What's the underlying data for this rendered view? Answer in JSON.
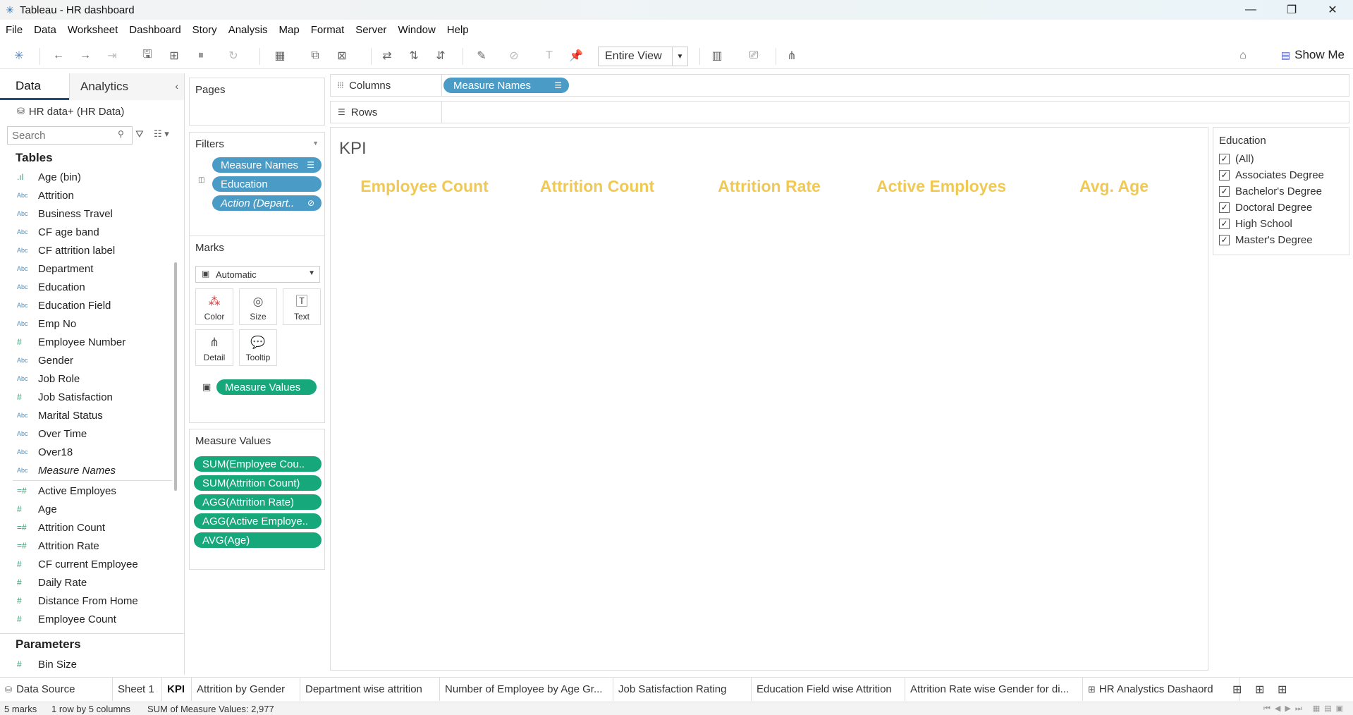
{
  "window": {
    "title": "Tableau - HR dashboard",
    "minimize": "—",
    "restore": "❐",
    "close": "✕"
  },
  "menu": [
    "File",
    "Data",
    "Worksheet",
    "Dashboard",
    "Story",
    "Analysis",
    "Map",
    "Format",
    "Server",
    "Window",
    "Help"
  ],
  "toolbar": {
    "view_mode": "Entire View",
    "show_me": "Show Me"
  },
  "left_panel": {
    "tabs": {
      "data": "Data",
      "analytics": "Analytics"
    },
    "datasource": "HR data+ (HR Data)",
    "search_placeholder": "Search",
    "tables_heading": "Tables",
    "dimensions": [
      {
        "type": "bin",
        "name": "Age (bin)"
      },
      {
        "type": "Abc",
        "name": "Attrition"
      },
      {
        "type": "Abc",
        "name": "Business Travel"
      },
      {
        "type": "Abc",
        "name": "CF age band"
      },
      {
        "type": "Abc",
        "name": "CF attrition label"
      },
      {
        "type": "Abc",
        "name": "Department"
      },
      {
        "type": "Abc",
        "name": "Education"
      },
      {
        "type": "Abc",
        "name": "Education Field"
      },
      {
        "type": "Abc",
        "name": "Emp No"
      },
      {
        "type": "#",
        "name": "Employee Number"
      },
      {
        "type": "Abc",
        "name": "Gender"
      },
      {
        "type": "Abc",
        "name": "Job Role"
      },
      {
        "type": "#",
        "name": "Job Satisfaction"
      },
      {
        "type": "Abc",
        "name": "Marital Status"
      },
      {
        "type": "Abc",
        "name": "Over Time"
      },
      {
        "type": "Abc",
        "name": "Over18"
      },
      {
        "type": "Abc",
        "name": "Measure Names"
      }
    ],
    "measures": [
      {
        "type": "=#",
        "name": "Active Employes"
      },
      {
        "type": "#",
        "name": "Age"
      },
      {
        "type": "=#",
        "name": "Attrition Count"
      },
      {
        "type": "=#",
        "name": "Attrition Rate"
      },
      {
        "type": "#",
        "name": "CF current Employee"
      },
      {
        "type": "#",
        "name": "Daily Rate"
      },
      {
        "type": "#",
        "name": "Distance From Home"
      },
      {
        "type": "#",
        "name": "Employee Count"
      }
    ],
    "parameters_heading": "Parameters",
    "parameters": [
      {
        "type": "#",
        "name": "Bin Size"
      }
    ]
  },
  "cards": {
    "pages": "Pages",
    "filters": {
      "title": "Filters",
      "pills": [
        "Measure Names",
        "Education",
        "Action (Depart.."
      ]
    },
    "marks": {
      "title": "Marks",
      "type": "Automatic",
      "buttons": [
        "Color",
        "Size",
        "Text",
        "Detail",
        "Tooltip"
      ],
      "pill": "Measure Values"
    },
    "measure_values": {
      "title": "Measure Values",
      "pills": [
        "SUM(Employee Cou..",
        "SUM(Attrition Count)",
        "AGG(Attrition Rate)",
        "AGG(Active Employe..",
        "AVG(Age)"
      ]
    }
  },
  "shelves": {
    "columns_label": "Columns",
    "columns_pill": "Measure Names",
    "rows_label": "Rows"
  },
  "view": {
    "title": "KPI",
    "headers": [
      "Employee Count",
      "Attrition Count",
      "Attrition Rate",
      "Active Employes",
      "Avg. Age"
    ],
    "header_color": "#f0c955"
  },
  "education_filter": {
    "title": "Education",
    "options": [
      {
        "label": "(All)",
        "checked": true
      },
      {
        "label": "Associates Degree",
        "checked": true
      },
      {
        "label": "Bachelor's Degree",
        "checked": true
      },
      {
        "label": "Doctoral Degree",
        "checked": true
      },
      {
        "label": "High School",
        "checked": true
      },
      {
        "label": "Master's Degree",
        "checked": true
      }
    ]
  },
  "sheet_tabs": [
    {
      "label": "Data Source",
      "active": false
    },
    {
      "label": "Sheet 1",
      "active": false
    },
    {
      "label": "KPI",
      "active": true
    },
    {
      "label": "Attrition by Gender",
      "active": false
    },
    {
      "label": "Department wise attrition",
      "active": false
    },
    {
      "label": "Number of Employee by Age Gr...",
      "active": false
    },
    {
      "label": "Job Satisfaction Rating",
      "active": false
    },
    {
      "label": "Education Field wise Attrition",
      "active": false
    },
    {
      "label": "Attrition Rate wise Gender for di...",
      "active": false
    },
    {
      "label": "HR Analystics Dashaord",
      "active": false
    }
  ],
  "status": {
    "marks": "5 marks",
    "dims": "1 row by 5 columns",
    "sum": "SUM of Measure Values: 2,977"
  },
  "colors": {
    "blue_pill": "#4a9cc7",
    "green_pill": "#16a77a",
    "accent": "#1f4e79"
  }
}
